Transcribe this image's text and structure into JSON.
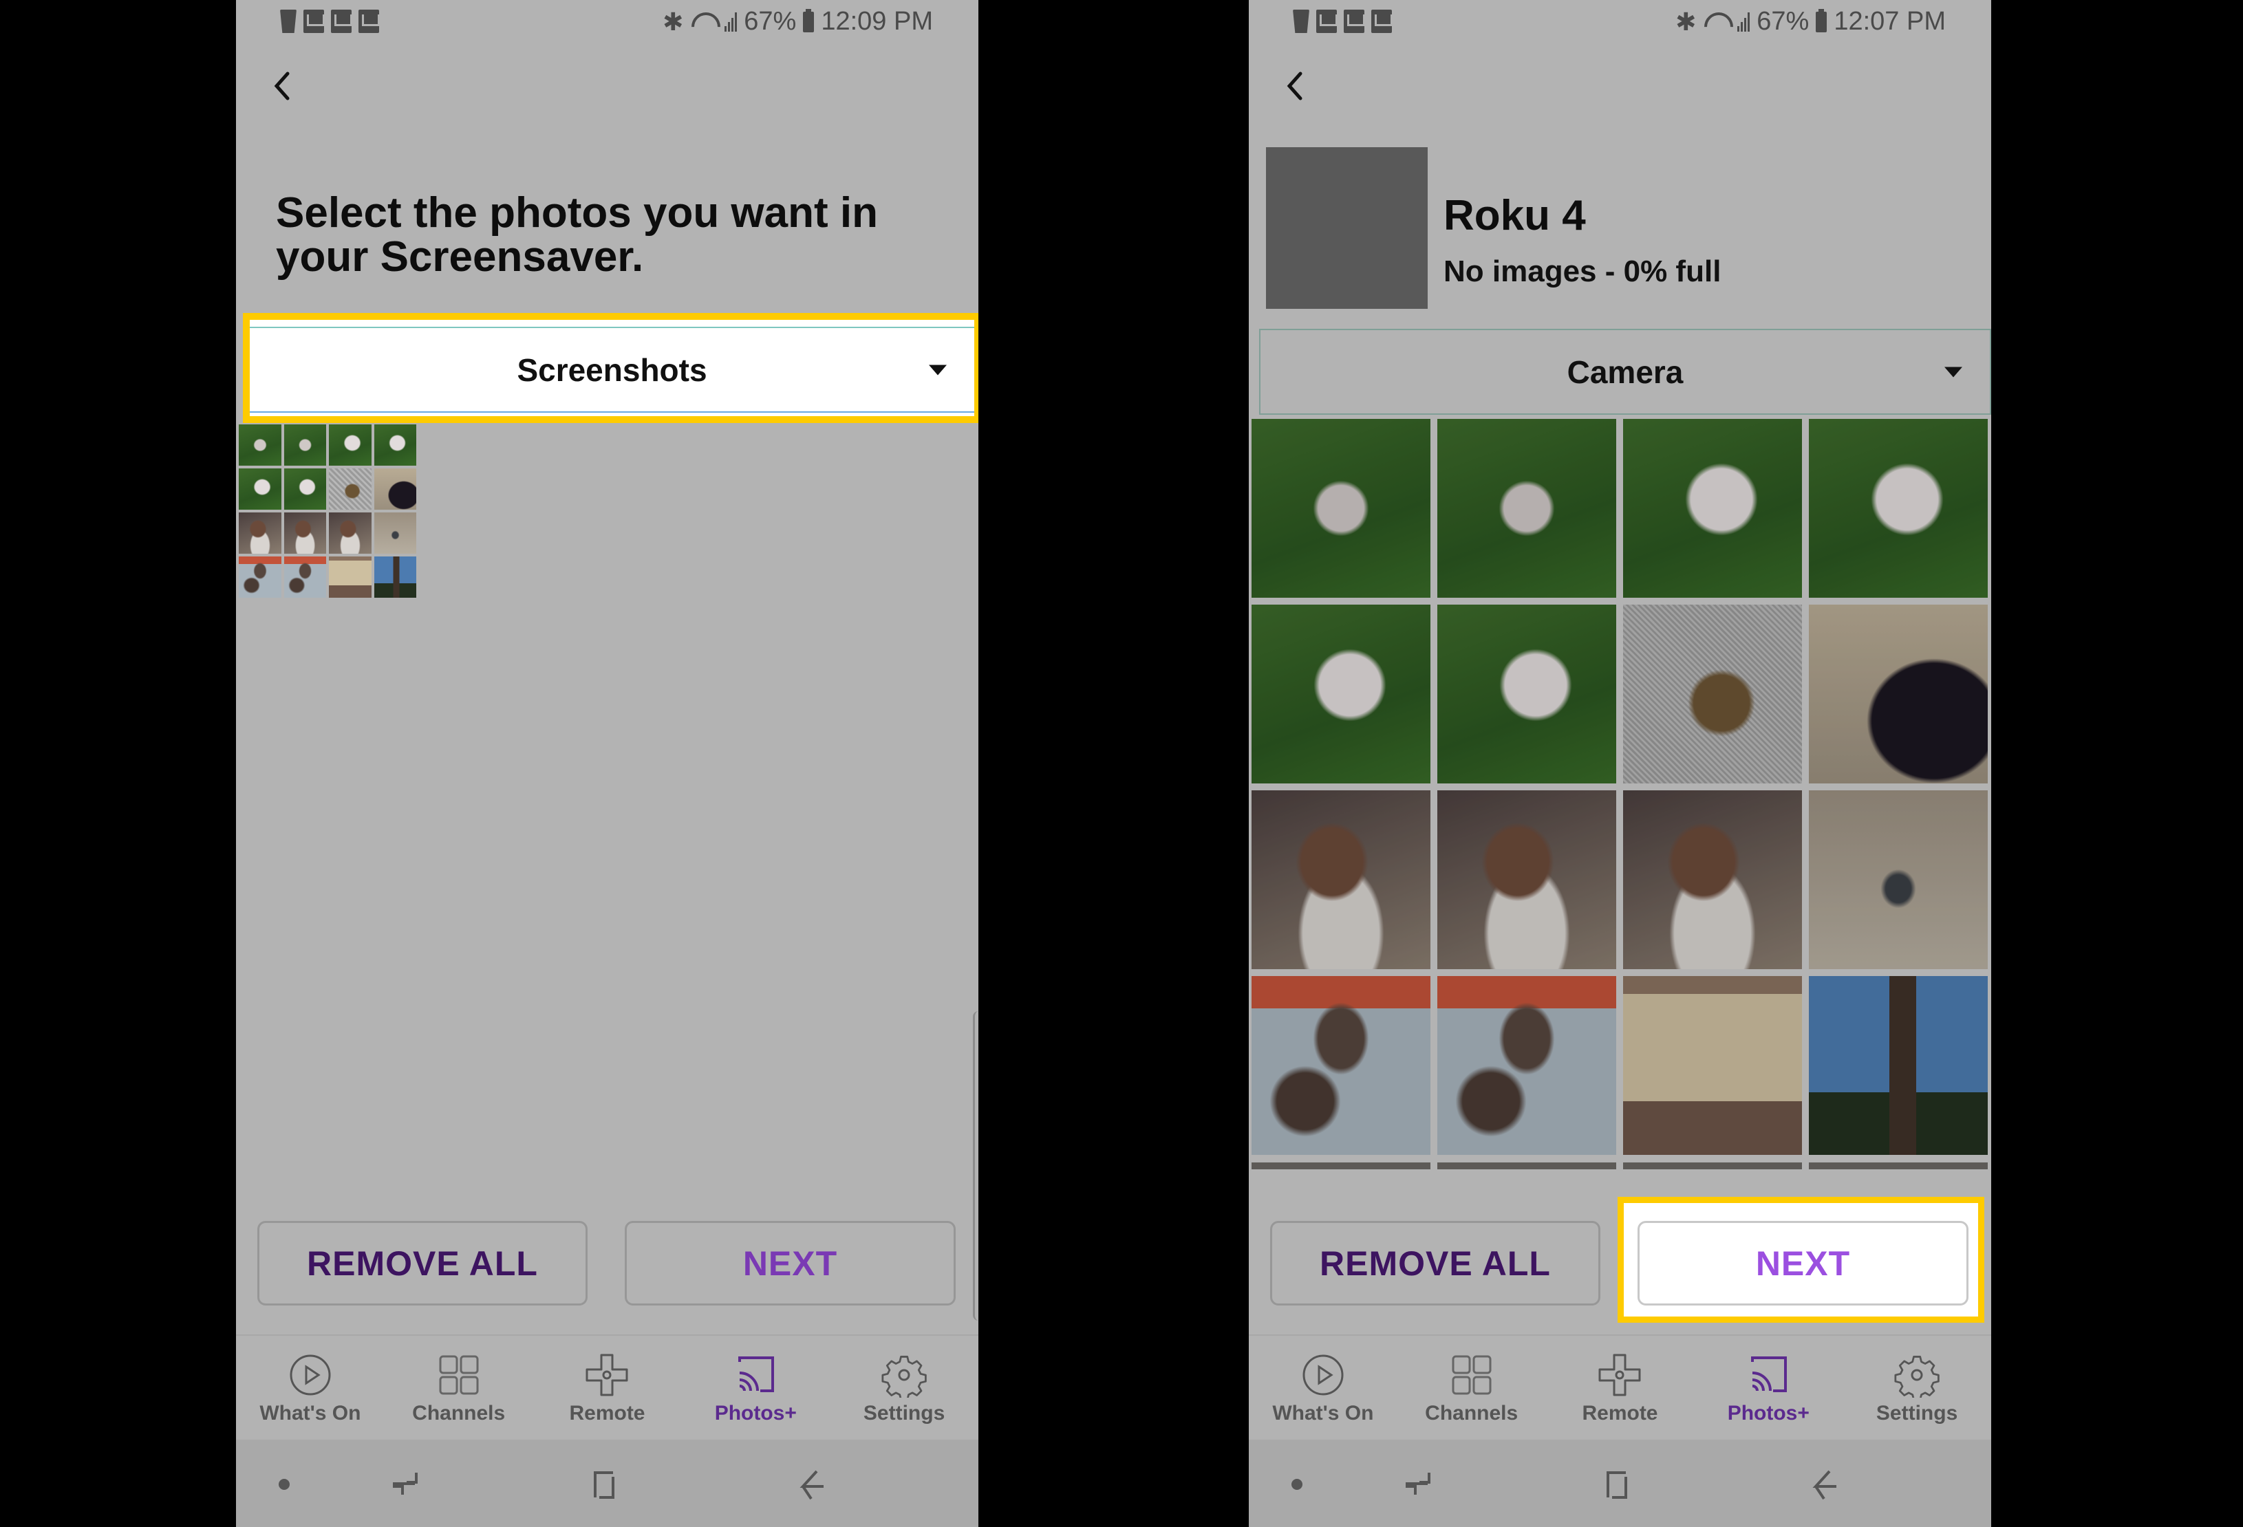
{
  "left_screen": {
    "status_bar": {
      "notification_icons": [
        "cup-icon",
        "gmail-icon",
        "inbox-icon",
        "gmail-icon"
      ],
      "battery_percent": "67%",
      "time": "12:09 PM"
    },
    "title": "Select the photos you want in your Screensaver.",
    "album_dropdown": {
      "selected": "Screenshots",
      "highlighted": true
    },
    "thumbnails_count": 16,
    "buttons": {
      "remove_all": "REMOVE ALL",
      "next": "NEXT"
    }
  },
  "right_screen": {
    "status_bar": {
      "notification_icons": [
        "cup-icon",
        "gmail-icon",
        "inbox-icon",
        "gmail-icon"
      ],
      "battery_percent": "67%",
      "time": "12:07 PM"
    },
    "device": {
      "name": "Roku 4",
      "status": "No images - 0% full",
      "storage_full_percent": 0
    },
    "album_dropdown": {
      "selected": "Camera",
      "highlighted": false
    },
    "photos": [
      {
        "subject": "dog-in-grass"
      },
      {
        "subject": "dog-in-grass"
      },
      {
        "subject": "white-dog-in-grass"
      },
      {
        "subject": "white-dog-in-grass"
      },
      {
        "subject": "dog-rolling-in-grass"
      },
      {
        "subject": "dog-rolling-in-grass"
      },
      {
        "subject": "turtle-on-gravel"
      },
      {
        "subject": "black-cat"
      },
      {
        "subject": "dog-face"
      },
      {
        "subject": "dog-face"
      },
      {
        "subject": "dog-face"
      },
      {
        "subject": "bird-on-sand"
      },
      {
        "subject": "two-dogs-on-bed"
      },
      {
        "subject": "two-dogs-on-bed"
      },
      {
        "subject": "package-label"
      },
      {
        "subject": "totem-pole"
      }
    ],
    "buttons": {
      "remove_all": "REMOVE ALL",
      "next": "NEXT",
      "next_highlighted": true
    }
  },
  "tabbar": {
    "items": [
      {
        "label": "What's On",
        "icon": "play-circle-icon",
        "active": false
      },
      {
        "label": "Channels",
        "icon": "grid-icon",
        "active": false
      },
      {
        "label": "Remote",
        "icon": "dpad-icon",
        "active": false
      },
      {
        "label": "Photos+",
        "icon": "cast-icon",
        "active": true
      },
      {
        "label": "Settings",
        "icon": "gear-icon",
        "active": false
      }
    ]
  },
  "navbar": {
    "items": [
      "dot-icon",
      "recents-icon",
      "home-icon",
      "back-icon"
    ]
  },
  "colors": {
    "highlight": "#fecb00",
    "brand_purple": "#5b2a8e",
    "next_purple": "#9b4fe0",
    "screen_dim": "#b3b3b3"
  }
}
